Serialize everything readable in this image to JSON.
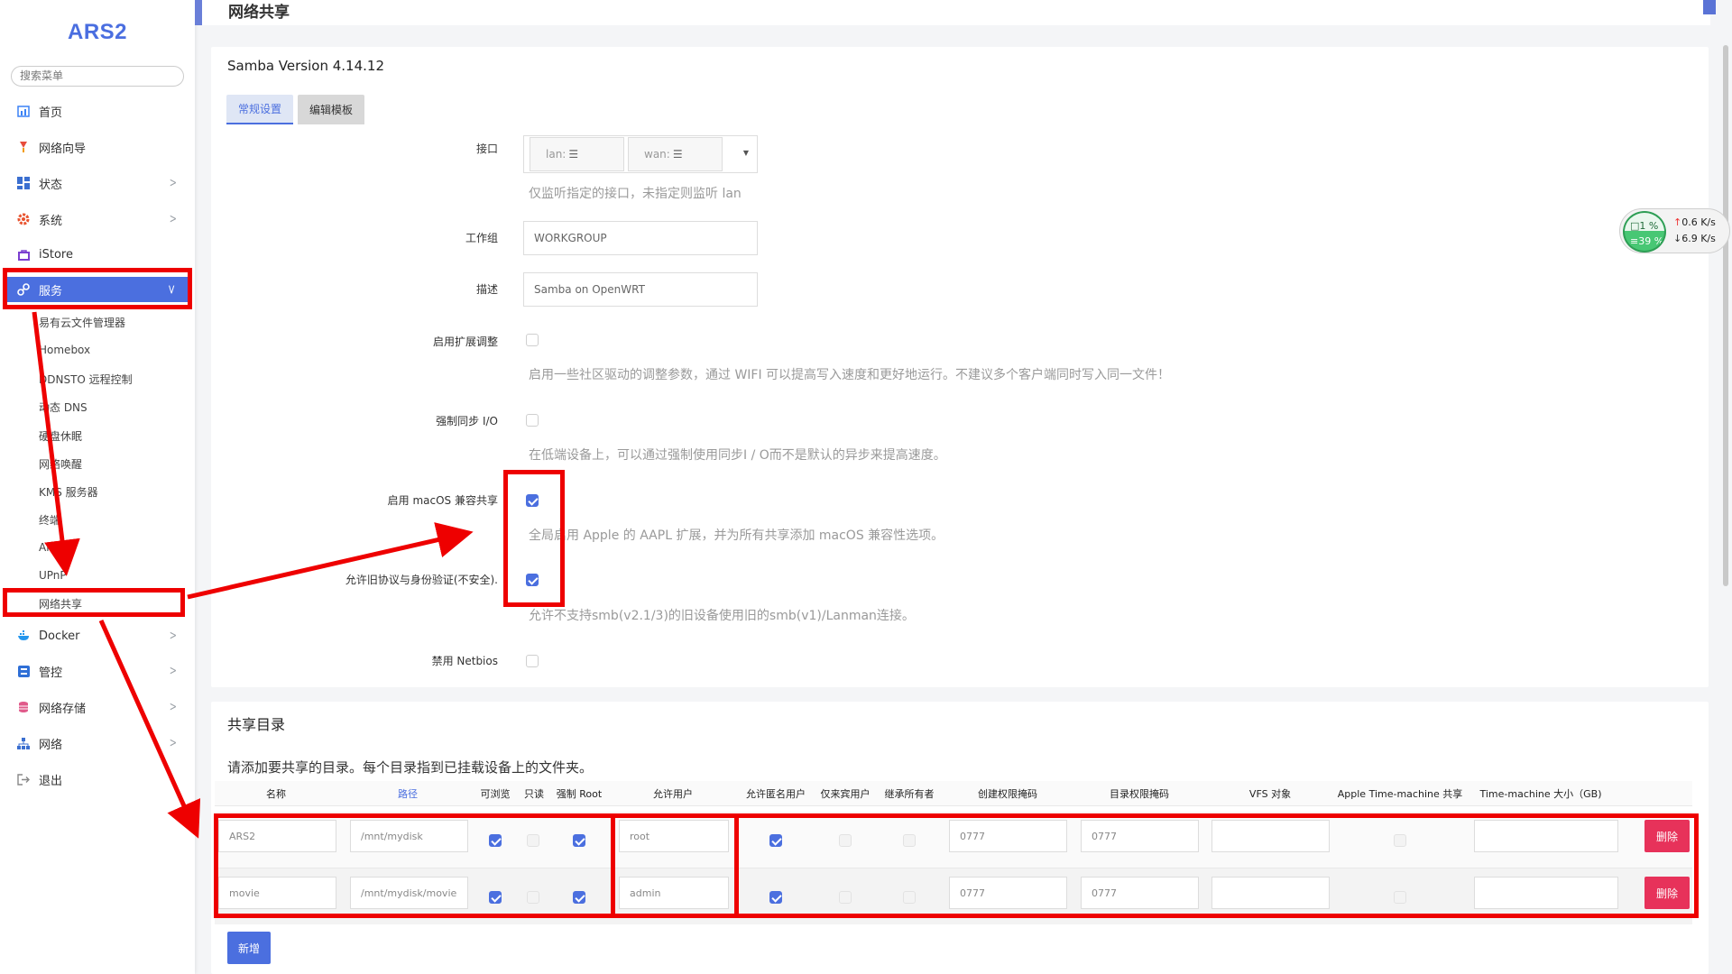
{
  "app": {
    "brand": "ARS2",
    "search_placeholder": "搜索菜单",
    "page_title": "网络共享"
  },
  "nav": [
    {
      "label": "首页",
      "icon": "home-icon"
    },
    {
      "label": "网络向导",
      "icon": "wizard-icon"
    },
    {
      "label": "状态",
      "icon": "dashboard-icon"
    },
    {
      "label": "系统",
      "icon": "gear-icon"
    },
    {
      "label": "iStore",
      "icon": "store-icon"
    },
    {
      "label": "服务",
      "icon": "services-icon"
    },
    {
      "label": "Docker",
      "icon": "docker-icon"
    },
    {
      "label": "管控",
      "icon": "control-icon"
    },
    {
      "label": "网络存储",
      "icon": "storage-icon"
    },
    {
      "label": "网络",
      "icon": "network-icon"
    },
    {
      "label": "退出",
      "icon": "logout-icon"
    }
  ],
  "service_items": [
    "易有云文件管理器",
    "Homebox",
    "DDNSTO 远程控制",
    "动态 DNS",
    "硬盘休眠",
    "网络唤醒",
    "KMS 服务器",
    "终端",
    "ArPing",
    "UPnP",
    "网络共享"
  ],
  "samba": {
    "version": "Samba Version 4.14.12",
    "tabs": [
      "常规设置",
      "编辑模板"
    ],
    "interface": {
      "label": "接口",
      "chips": [
        "lan:",
        "wan:"
      ],
      "help": "仅监听指定的接口，未指定则监听 lan"
    },
    "workgroup": {
      "label": "工作组",
      "value": "WORKGROUP"
    },
    "description": {
      "label": "描述",
      "value": "Samba on OpenWRT"
    },
    "ext_tuning": {
      "label": "启用扩展调整",
      "checked": false,
      "help": "启用一些社区驱动的调整参数，通过 WIFI 可以提高写入速度和更好地运行。不建议多个客户端同时写入同一文件！"
    },
    "sync_io": {
      "label": "强制同步 I/O",
      "checked": false,
      "help": "在低端设备上，可以通过强制使用同步I / O而不是默认的异步来提高速度。"
    },
    "macos": {
      "label": "启用 macOS 兼容共享",
      "checked": true,
      "help": "全局启用 Apple 的 AAPL 扩展，并为所有共享添加 macOS 兼容性选项。"
    },
    "legacy": {
      "label": "允许旧协议与身份验证(不安全).",
      "checked": true,
      "help": "允许不支持smb(v2.1/3)的旧设备使用旧的smb(v1)/Lanman连接。"
    },
    "netbios": {
      "label": "禁用 Netbios",
      "checked": false
    }
  },
  "shares": {
    "title": "共享目录",
    "desc": "请添加要共享的目录。每个目录指到已挂载设备上的文件夹。",
    "columns": [
      "名称",
      "路径",
      "可浏览",
      "只读",
      "强制 Root",
      "允许用户",
      "允许匿名用户",
      "仅来宾用户",
      "继承所有者",
      "创建权限掩码",
      "目录权限掩码",
      "VFS 对象",
      "Apple Time-machine 共享",
      "Time-machine 大小（GB)"
    ],
    "rows": [
      {
        "name": "ARS2",
        "path": "/mnt/mydisk",
        "browseable": true,
        "readonly": false,
        "force_root": true,
        "users": "root",
        "guest_ok": true,
        "guest_only": false,
        "inherit_owner": false,
        "create_mask": "0777",
        "dir_mask": "0777",
        "vfs": "",
        "timemachine": false,
        "tm_size": ""
      },
      {
        "name": "movie",
        "path": "/mnt/mydisk/movie",
        "browseable": true,
        "readonly": false,
        "force_root": true,
        "users": "admin",
        "guest_ok": true,
        "guest_only": false,
        "inherit_owner": false,
        "create_mask": "0777",
        "dir_mask": "0777",
        "vfs": "",
        "timemachine": false,
        "tm_size": ""
      }
    ],
    "delete_label": "删除",
    "add_label": "新增"
  },
  "netmon": {
    "cpu": "1 %",
    "mem": "39 %",
    "up": "0.6 K/s",
    "down": "6.9 K/s"
  },
  "colors": {
    "accent": "#4b6fdf",
    "danger": "#e7325a",
    "annotation": "#ee0000"
  }
}
